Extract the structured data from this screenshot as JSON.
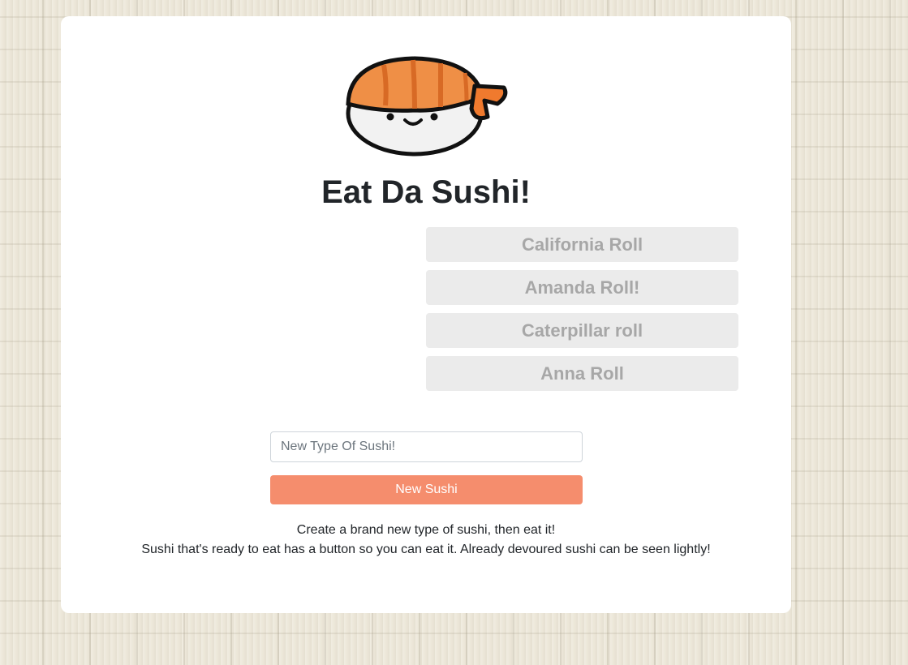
{
  "logo": {
    "icon": "sushi-mascot-icon",
    "colors": {
      "salmon": "#ef8f46",
      "band": "#f07a2e",
      "outline": "#111111"
    }
  },
  "page": {
    "title": "Eat Da Sushi!"
  },
  "sushi_list": {
    "items": [
      {
        "label": "California Roll",
        "devoured": true
      },
      {
        "label": "Amanda Roll!",
        "devoured": true
      },
      {
        "label": "Caterpillar roll",
        "devoured": true
      },
      {
        "label": "Anna Roll",
        "devoured": true
      }
    ]
  },
  "form": {
    "input_placeholder": "New Type Of Sushi!",
    "input_value": "",
    "submit_label": "New Sushi",
    "accent_color": "#f58d6d"
  },
  "description": {
    "line1": "Create a brand new type of sushi, then eat it!",
    "line2": "Sushi that's ready to eat has a button so you can eat it. Already devoured sushi can be seen lightly!"
  }
}
